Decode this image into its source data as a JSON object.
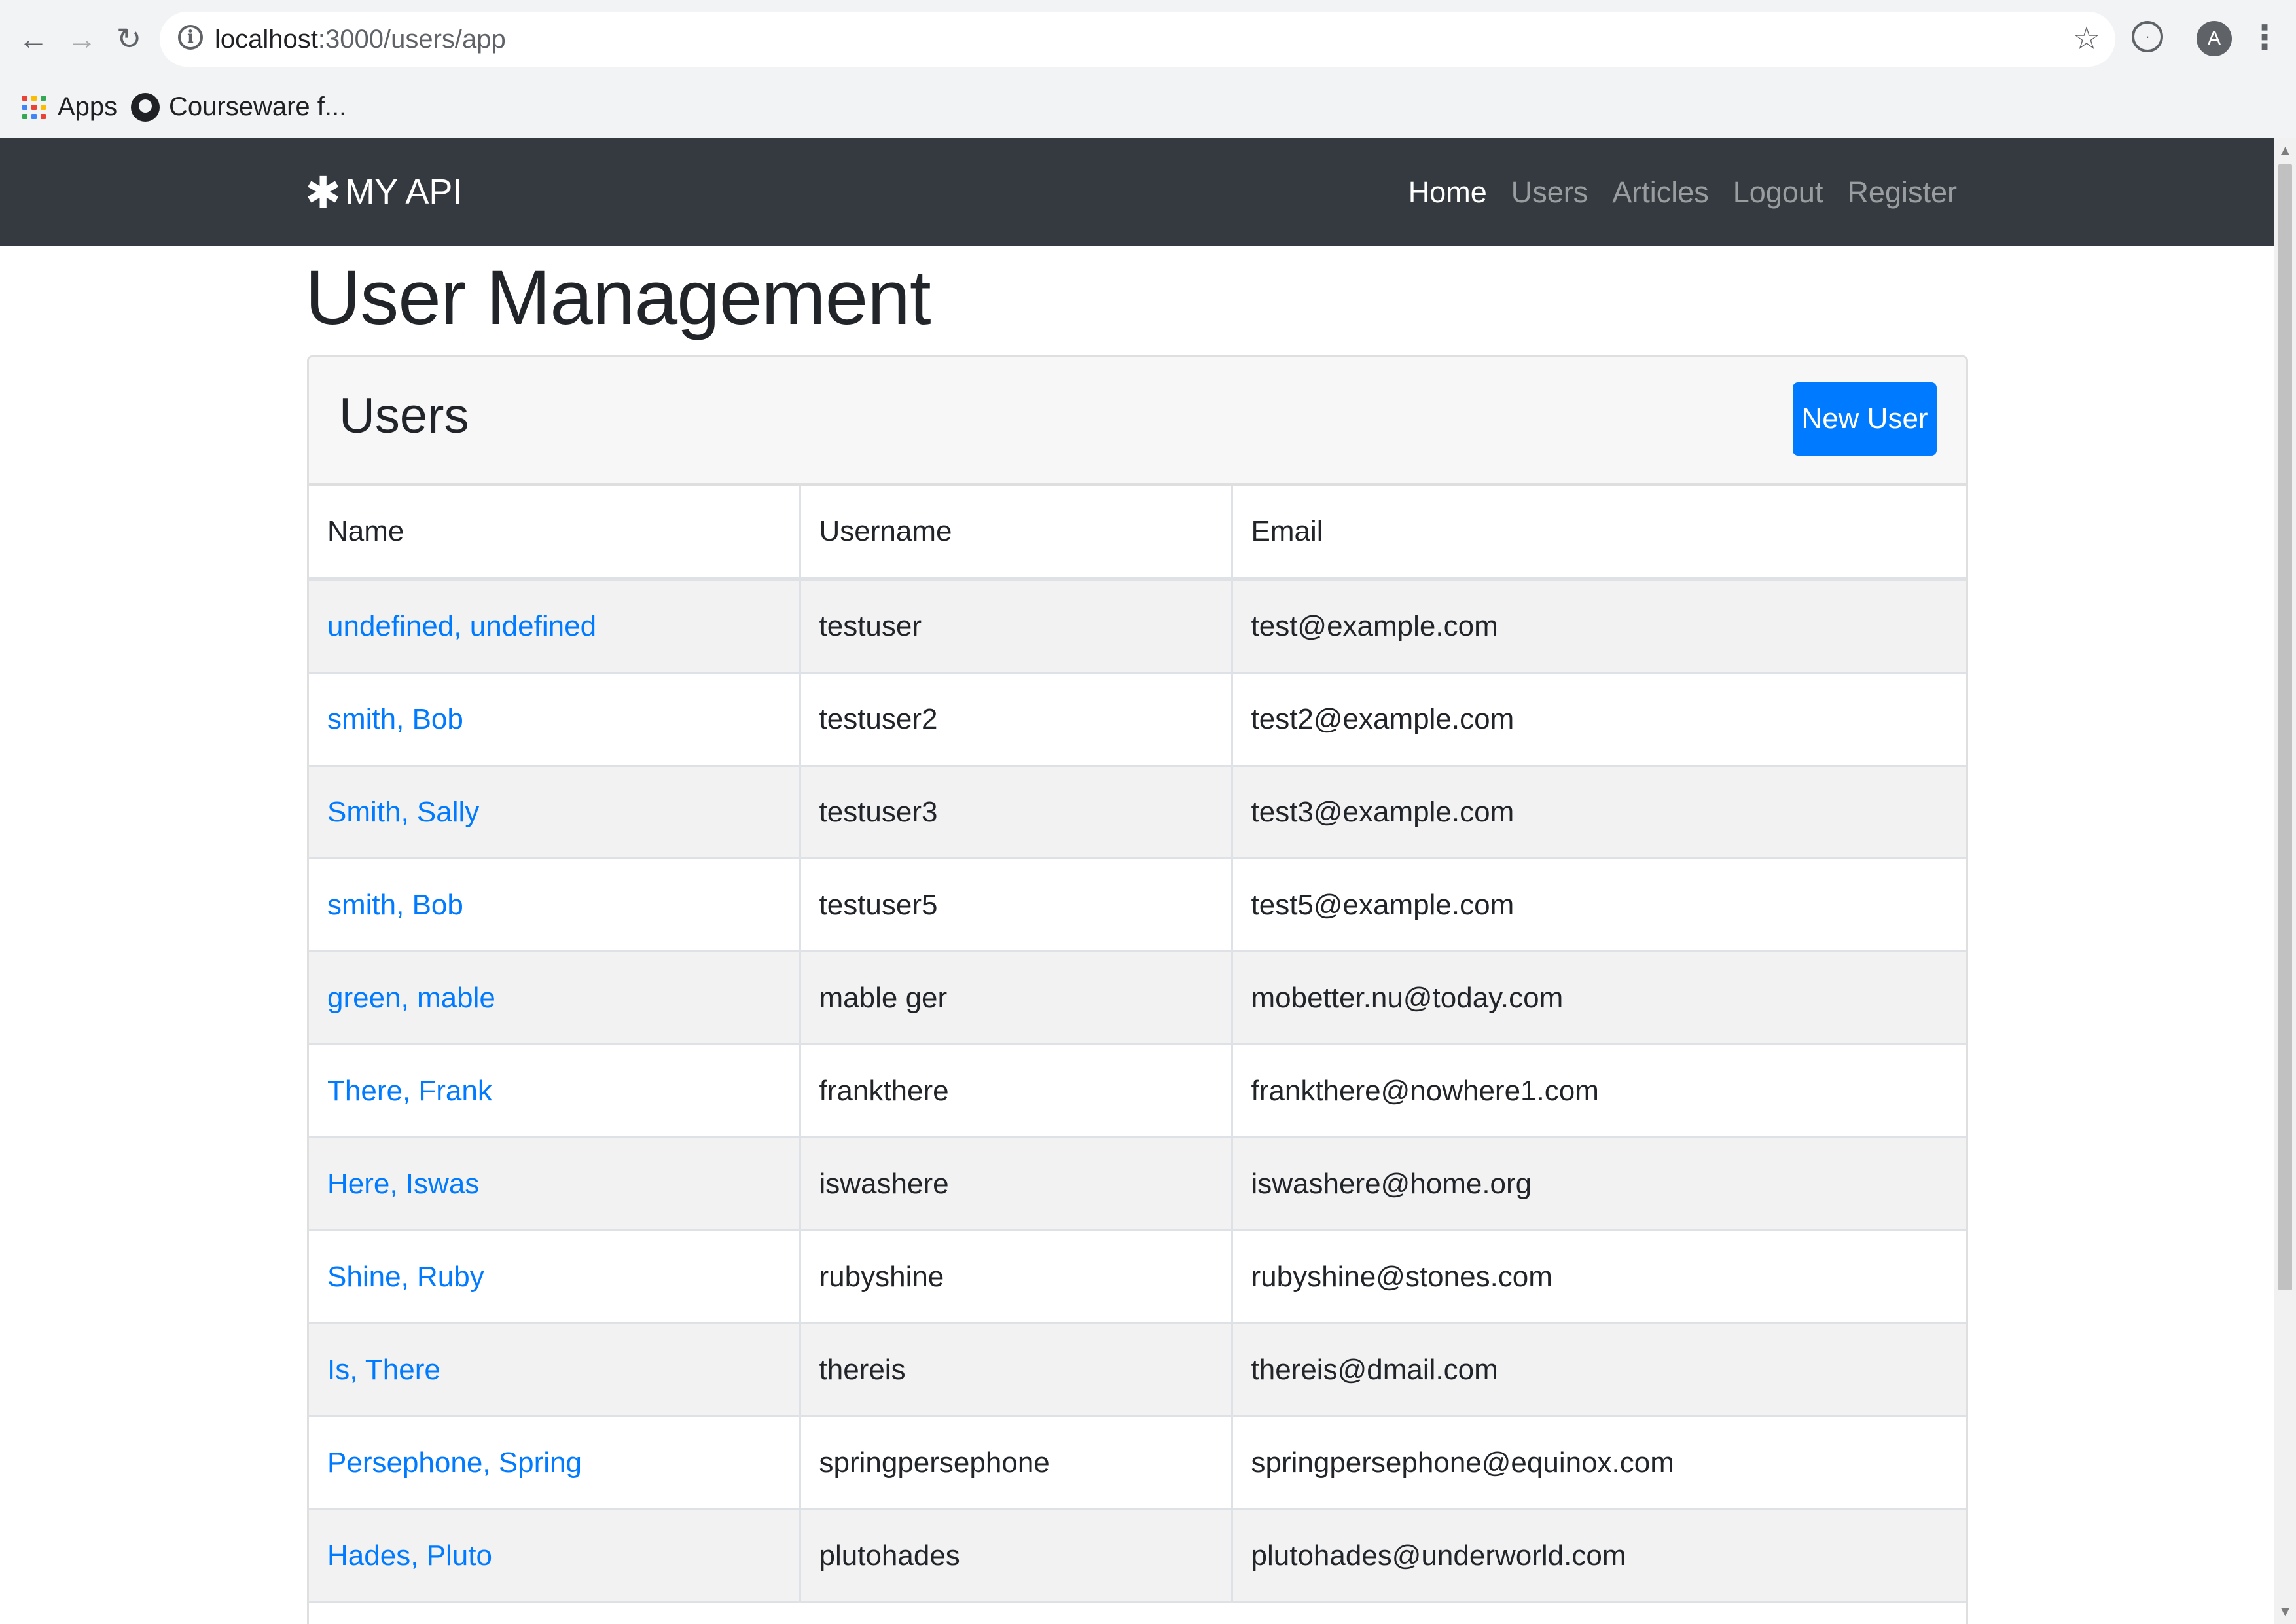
{
  "browser": {
    "url_host": "localhost",
    "url_rest": ":3000/users/app",
    "avatar_letter": "A",
    "bookmarks": [
      {
        "label": "Apps",
        "icon": "apps-grid-icon"
      },
      {
        "label": "Courseware f...",
        "icon": "github-icon"
      }
    ]
  },
  "navbar": {
    "brand": "MY API",
    "brand_icon": "✱",
    "links": [
      {
        "label": "Home",
        "active": true
      },
      {
        "label": "Users",
        "active": false
      },
      {
        "label": "Articles",
        "active": false
      },
      {
        "label": "Logout",
        "active": false
      },
      {
        "label": "Register",
        "active": false
      }
    ]
  },
  "page": {
    "title": "User Management"
  },
  "card": {
    "title": "Users",
    "new_user_label": "New User"
  },
  "table": {
    "columns": [
      "Name",
      "Username",
      "Email"
    ],
    "rows": [
      {
        "name": "undefined, undefined",
        "username": "testuser",
        "email": "test@example.com"
      },
      {
        "name": "smith, Bob",
        "username": "testuser2",
        "email": "test2@example.com"
      },
      {
        "name": "Smith, Sally",
        "username": "testuser3",
        "email": "test3@example.com"
      },
      {
        "name": "smith, Bob",
        "username": "testuser5",
        "email": "test5@example.com"
      },
      {
        "name": "green, mable",
        "username": "mable ger",
        "email": "mobetter.nu@today.com"
      },
      {
        "name": "There, Frank",
        "username": "frankthere",
        "email": "frankthere@nowhere1.com"
      },
      {
        "name": "Here, Iswas",
        "username": "iswashere",
        "email": "iswashere@home.org"
      },
      {
        "name": "Shine, Ruby",
        "username": "rubyshine",
        "email": "rubyshine@stones.com"
      },
      {
        "name": "Is, There",
        "username": "thereis",
        "email": "thereis@dmail.com"
      },
      {
        "name": "Persephone, Spring",
        "username": "springpersephone",
        "email": "springpersephone@equinox.com"
      },
      {
        "name": "Hades, Pluto",
        "username": "plutohades",
        "email": "plutohades@underworld.com"
      }
    ]
  },
  "colors": {
    "navbar_bg": "#343a40",
    "link": "#007bff",
    "primary_button": "#007bff"
  }
}
